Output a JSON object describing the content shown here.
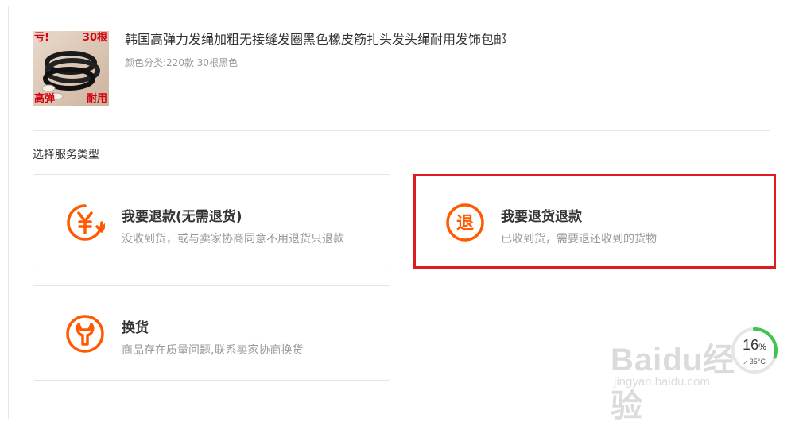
{
  "product": {
    "title": "韩国高弹力发绳加粗无接缝发圈黑色橡皮筋扎头发头绳耐用发饰包邮",
    "sku": "颜色分类:220款 30根黑色",
    "thumb_tags": {
      "top_left": "亏!",
      "top_right": "30根",
      "bottom_left": "高弹",
      "bottom_right": "耐用"
    }
  },
  "service": {
    "section_label": "选择服务类型",
    "options": [
      {
        "id": "refund",
        "title": "我要退款(无需退货)",
        "desc": "没收到货，或与卖家协商同意不用退货只退款",
        "icon": "yen-refund-icon"
      },
      {
        "id": "return",
        "title": "我要退货退款",
        "desc": "已收到货，需要退还收到的货物",
        "icon": "return-icon",
        "highlighted": true
      },
      {
        "id": "exchange",
        "title": "换货",
        "desc": "商品存在质量问题,联系卖家协商换货",
        "icon": "wrench-icon"
      }
    ]
  },
  "watermark": {
    "brand": "Baidu经验",
    "url": "jingyan.baidu.com"
  },
  "system_widget": {
    "percent": "16",
    "percent_unit": "%",
    "temp": "35°C",
    "level": 0.16
  },
  "colors": {
    "accent": "#ff5a00",
    "highlight_border": "#e11a22"
  }
}
